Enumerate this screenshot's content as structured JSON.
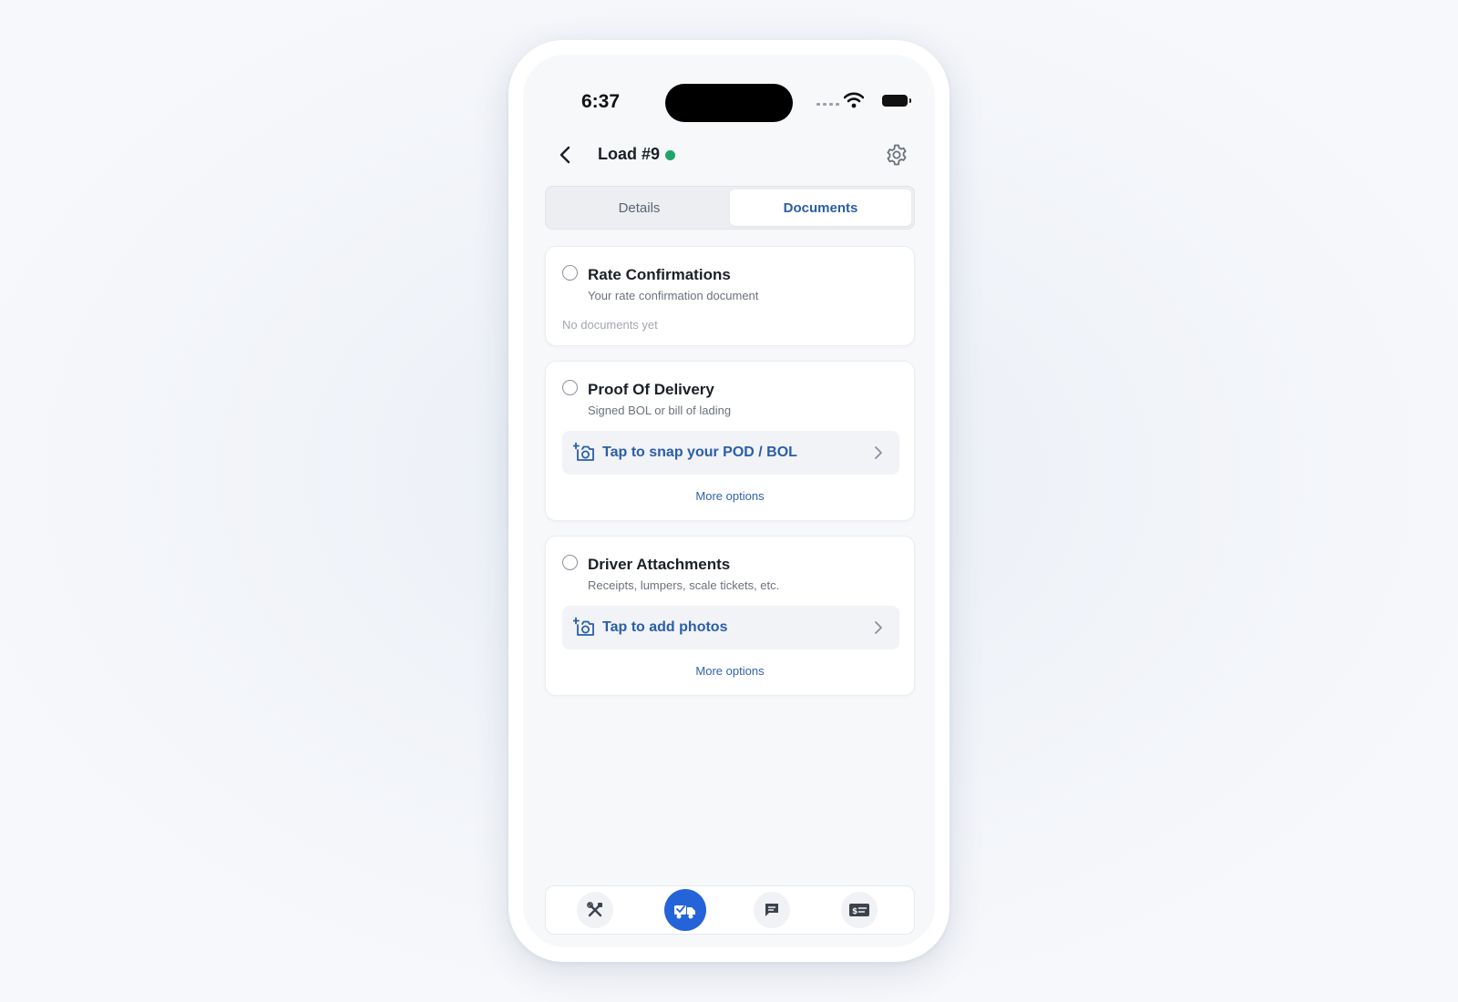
{
  "status_bar": {
    "time": "6:37"
  },
  "header": {
    "title": "Load #9",
    "status_color": "#21a56a"
  },
  "tabs": [
    {
      "label": "Details",
      "active": false
    },
    {
      "label": "Documents",
      "active": true
    }
  ],
  "cards": {
    "rate": {
      "title": "Rate Confirmations",
      "subtitle": "Your rate confirmation document",
      "empty": "No documents yet"
    },
    "pod": {
      "title": "Proof Of Delivery",
      "subtitle": "Signed BOL or bill of lading",
      "action": "Tap to snap your POD / BOL",
      "more": "More options"
    },
    "attachments": {
      "title": "Driver Attachments",
      "subtitle": "Receipts, lumpers, scale tickets, etc.",
      "action": "Tap to add photos",
      "more": "More options"
    }
  },
  "bottom_nav": [
    {
      "icon": "tools-icon",
      "active": false
    },
    {
      "icon": "truck-loads-icon",
      "active": true
    },
    {
      "icon": "chat-icon",
      "active": false
    },
    {
      "icon": "pay-card-icon",
      "active": false
    }
  ],
  "colors": {
    "accent": "#2563d8",
    "link": "#2a5ea8",
    "success": "#21a56a"
  }
}
